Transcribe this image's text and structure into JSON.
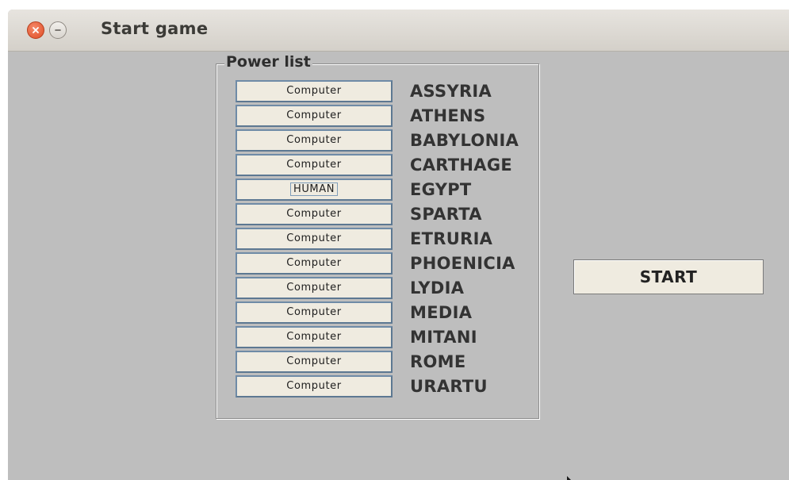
{
  "window": {
    "title": "Start game"
  },
  "power_list": {
    "legend": "Power list",
    "rows": [
      {
        "player": "Computer",
        "power": "ASSYRIA"
      },
      {
        "player": "Computer",
        "power": "ATHENS"
      },
      {
        "player": "Computer",
        "power": "BABYLONIA"
      },
      {
        "player": "Computer",
        "power": "CARTHAGE"
      },
      {
        "player": "HUMAN",
        "power": "EGYPT"
      },
      {
        "player": "Computer",
        "power": "SPARTA"
      },
      {
        "player": "Computer",
        "power": "ETRURIA"
      },
      {
        "player": "Computer",
        "power": "PHOENICIA"
      },
      {
        "player": "Computer",
        "power": "LYDIA"
      },
      {
        "player": "Computer",
        "power": "MEDIA"
      },
      {
        "player": "Computer",
        "power": "MITANI"
      },
      {
        "player": "Computer",
        "power": "ROME"
      },
      {
        "player": "Computer",
        "power": "URARTU"
      }
    ]
  },
  "start_button": {
    "label": "START"
  },
  "icons": {
    "close": "close-icon",
    "minimize": "minimize-icon",
    "cursor": "mouse-cursor-icon"
  },
  "colors": {
    "close_button": "#df4c25",
    "window_background": "#bebebe",
    "button_face": "#efebe0"
  }
}
